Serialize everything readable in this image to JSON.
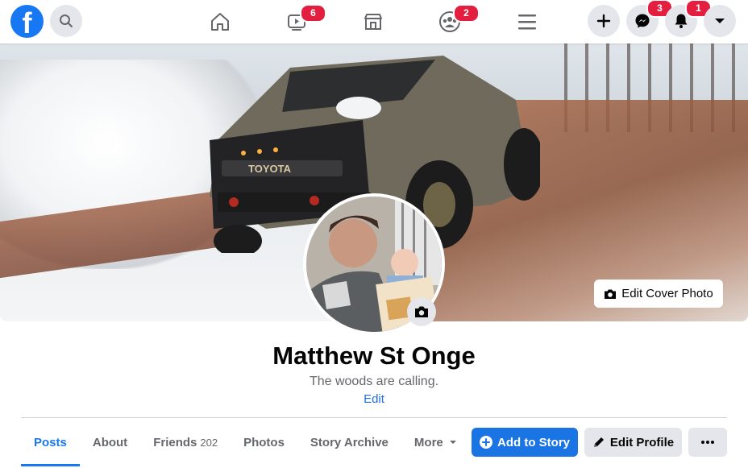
{
  "topbar": {
    "logo_letter": "f",
    "nav": [
      {
        "name": "home",
        "badge": ""
      },
      {
        "name": "watch",
        "badge": "6"
      },
      {
        "name": "marketplace",
        "badge": ""
      },
      {
        "name": "groups",
        "badge": "2"
      },
      {
        "name": "menu",
        "badge": ""
      }
    ],
    "messenger_badge": "3",
    "notifications_badge": "1"
  },
  "cover": {
    "edit_label": "Edit Cover Photo",
    "truck_text": "TOYOTA"
  },
  "profile": {
    "name": "Matthew St Onge",
    "bio": "The woods are calling.",
    "bio_edit": "Edit"
  },
  "tabs": [
    {
      "label": "Posts",
      "count": ""
    },
    {
      "label": "About",
      "count": ""
    },
    {
      "label": "Friends",
      "count": "202"
    },
    {
      "label": "Photos",
      "count": ""
    },
    {
      "label": "Story Archive",
      "count": ""
    },
    {
      "label": "More",
      "count": ""
    }
  ],
  "actions": {
    "add_story": "Add to Story",
    "edit_profile": "Edit Profile"
  },
  "colors": {
    "brand": "#1877f2",
    "badge": "#e41e3f"
  }
}
